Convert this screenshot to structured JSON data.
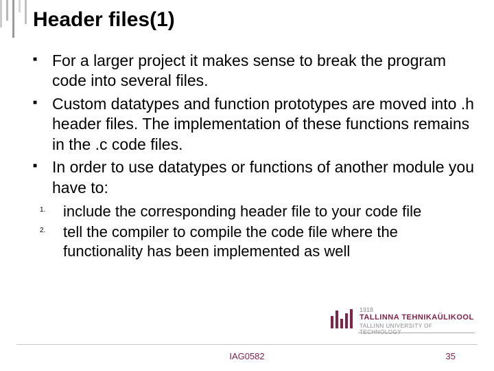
{
  "title": "Header files(1)",
  "bullets": [
    "For a larger project it makes sense to break the program code into several files.",
    "Custom datatypes and function prototypes are moved into .h header files. The implementation of these functions remains in the .c code files.",
    "In order to use datatypes or functions of another module you have to:"
  ],
  "numbered": [
    "include the corresponding header file to your code file",
    "tell the compiler to compile the code file where the functionality has been implemented as well"
  ],
  "logo": {
    "year": "1918",
    "line1": "TALLINNA TEHNIKAÜLIKOOL",
    "line2": "TALLINN UNIVERSITY OF TECHNOLOGY"
  },
  "footer": {
    "course_code": "IAG0582",
    "slide_number": "35"
  }
}
